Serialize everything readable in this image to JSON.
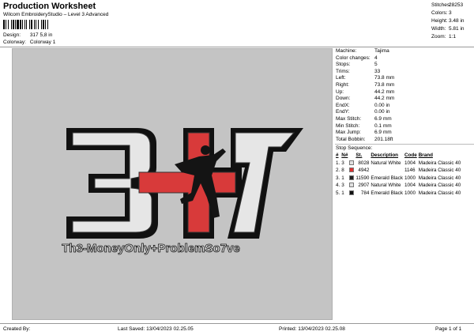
{
  "header": {
    "title": "Production Worksheet",
    "subtitle": "Wilcom EmbroideryStudio – Level 3 Advanced"
  },
  "design": {
    "label": "Design:",
    "value": "317 5,8 in"
  },
  "colorway": {
    "label": "Colorway:",
    "value": "Colorway 1"
  },
  "stats": [
    {
      "label": "Stitches:",
      "value": "28253"
    },
    {
      "label": "Colors:",
      "value": "3"
    },
    {
      "label": "Height:",
      "value": "3.48 in"
    },
    {
      "label": "Width:",
      "value": "5.81 in"
    },
    {
      "label": "Zoom:",
      "value": "1:1"
    }
  ],
  "machine_info": [
    {
      "label": "Machine:",
      "value": "Tajima"
    },
    {
      "label": "Color changes:",
      "value": "4"
    },
    {
      "label": "Stops:",
      "value": "5"
    },
    {
      "label": "Trims:",
      "value": "33"
    },
    {
      "label": "Left:",
      "value": "73.8 mm"
    },
    {
      "label": "Right:",
      "value": "73.8 mm"
    },
    {
      "label": "Up:",
      "value": "44.2 mm"
    },
    {
      "label": "Down:",
      "value": "44.2 mm"
    },
    {
      "label": "EndX:",
      "value": "0.00 in"
    },
    {
      "label": "EndY:",
      "value": "0.00 in"
    },
    {
      "label": "Max Stitch:",
      "value": "6.9 mm"
    },
    {
      "label": "Min Stitch:",
      "value": "0.1 mm"
    },
    {
      "label": "Max Jump:",
      "value": "6.9 mm"
    },
    {
      "label": "Total Bobbin:",
      "value": "201.18ft"
    }
  ],
  "stop_sequence": {
    "title": "Stop Sequence:",
    "headers": {
      "num": "#",
      "n": "N#",
      "st": "St.",
      "desc": "Description",
      "code": "Code",
      "brand": "Brand"
    },
    "rows": [
      {
        "num": "1.",
        "n": "3",
        "color": "#e2e2e2",
        "st": "8028",
        "desc": "Natural White",
        "code": "1004",
        "brand": "Madeira Classic 40"
      },
      {
        "num": "2.",
        "n": "8",
        "color": "#e03030",
        "st": "4942",
        "desc": "",
        "code": "1146",
        "brand": "Madeira Classic 40"
      },
      {
        "num": "3.",
        "n": "1",
        "color": "#222222",
        "st": "11590",
        "desc": "Emerald Black",
        "code": "1000",
        "brand": "Madeira Classic 40"
      },
      {
        "num": "4.",
        "n": "3",
        "color": "#e2e2e2",
        "st": "2907",
        "desc": "Natural White",
        "code": "1004",
        "brand": "Madeira Classic 40"
      },
      {
        "num": "5.",
        "n": "1",
        "color": "#111111",
        "st": "784",
        "desc": "Emerald Black",
        "code": "1000",
        "brand": "Madeira Classic 40"
      }
    ]
  },
  "artwork": {
    "main_text": "317",
    "slogan": "Th3-MoneyOnly+ProblemSo7ve",
    "colors": {
      "white": "#e6e6e6",
      "red": "#d83a3a",
      "black": "#141414",
      "outline": "#111111"
    }
  },
  "footer": {
    "created_by": "Created By:",
    "last_saved": "Last Saved: 13/04/2023 02.25.05",
    "printed": "Printed: 13/04/2023 02.25.08",
    "page": "Page 1 of 1"
  }
}
